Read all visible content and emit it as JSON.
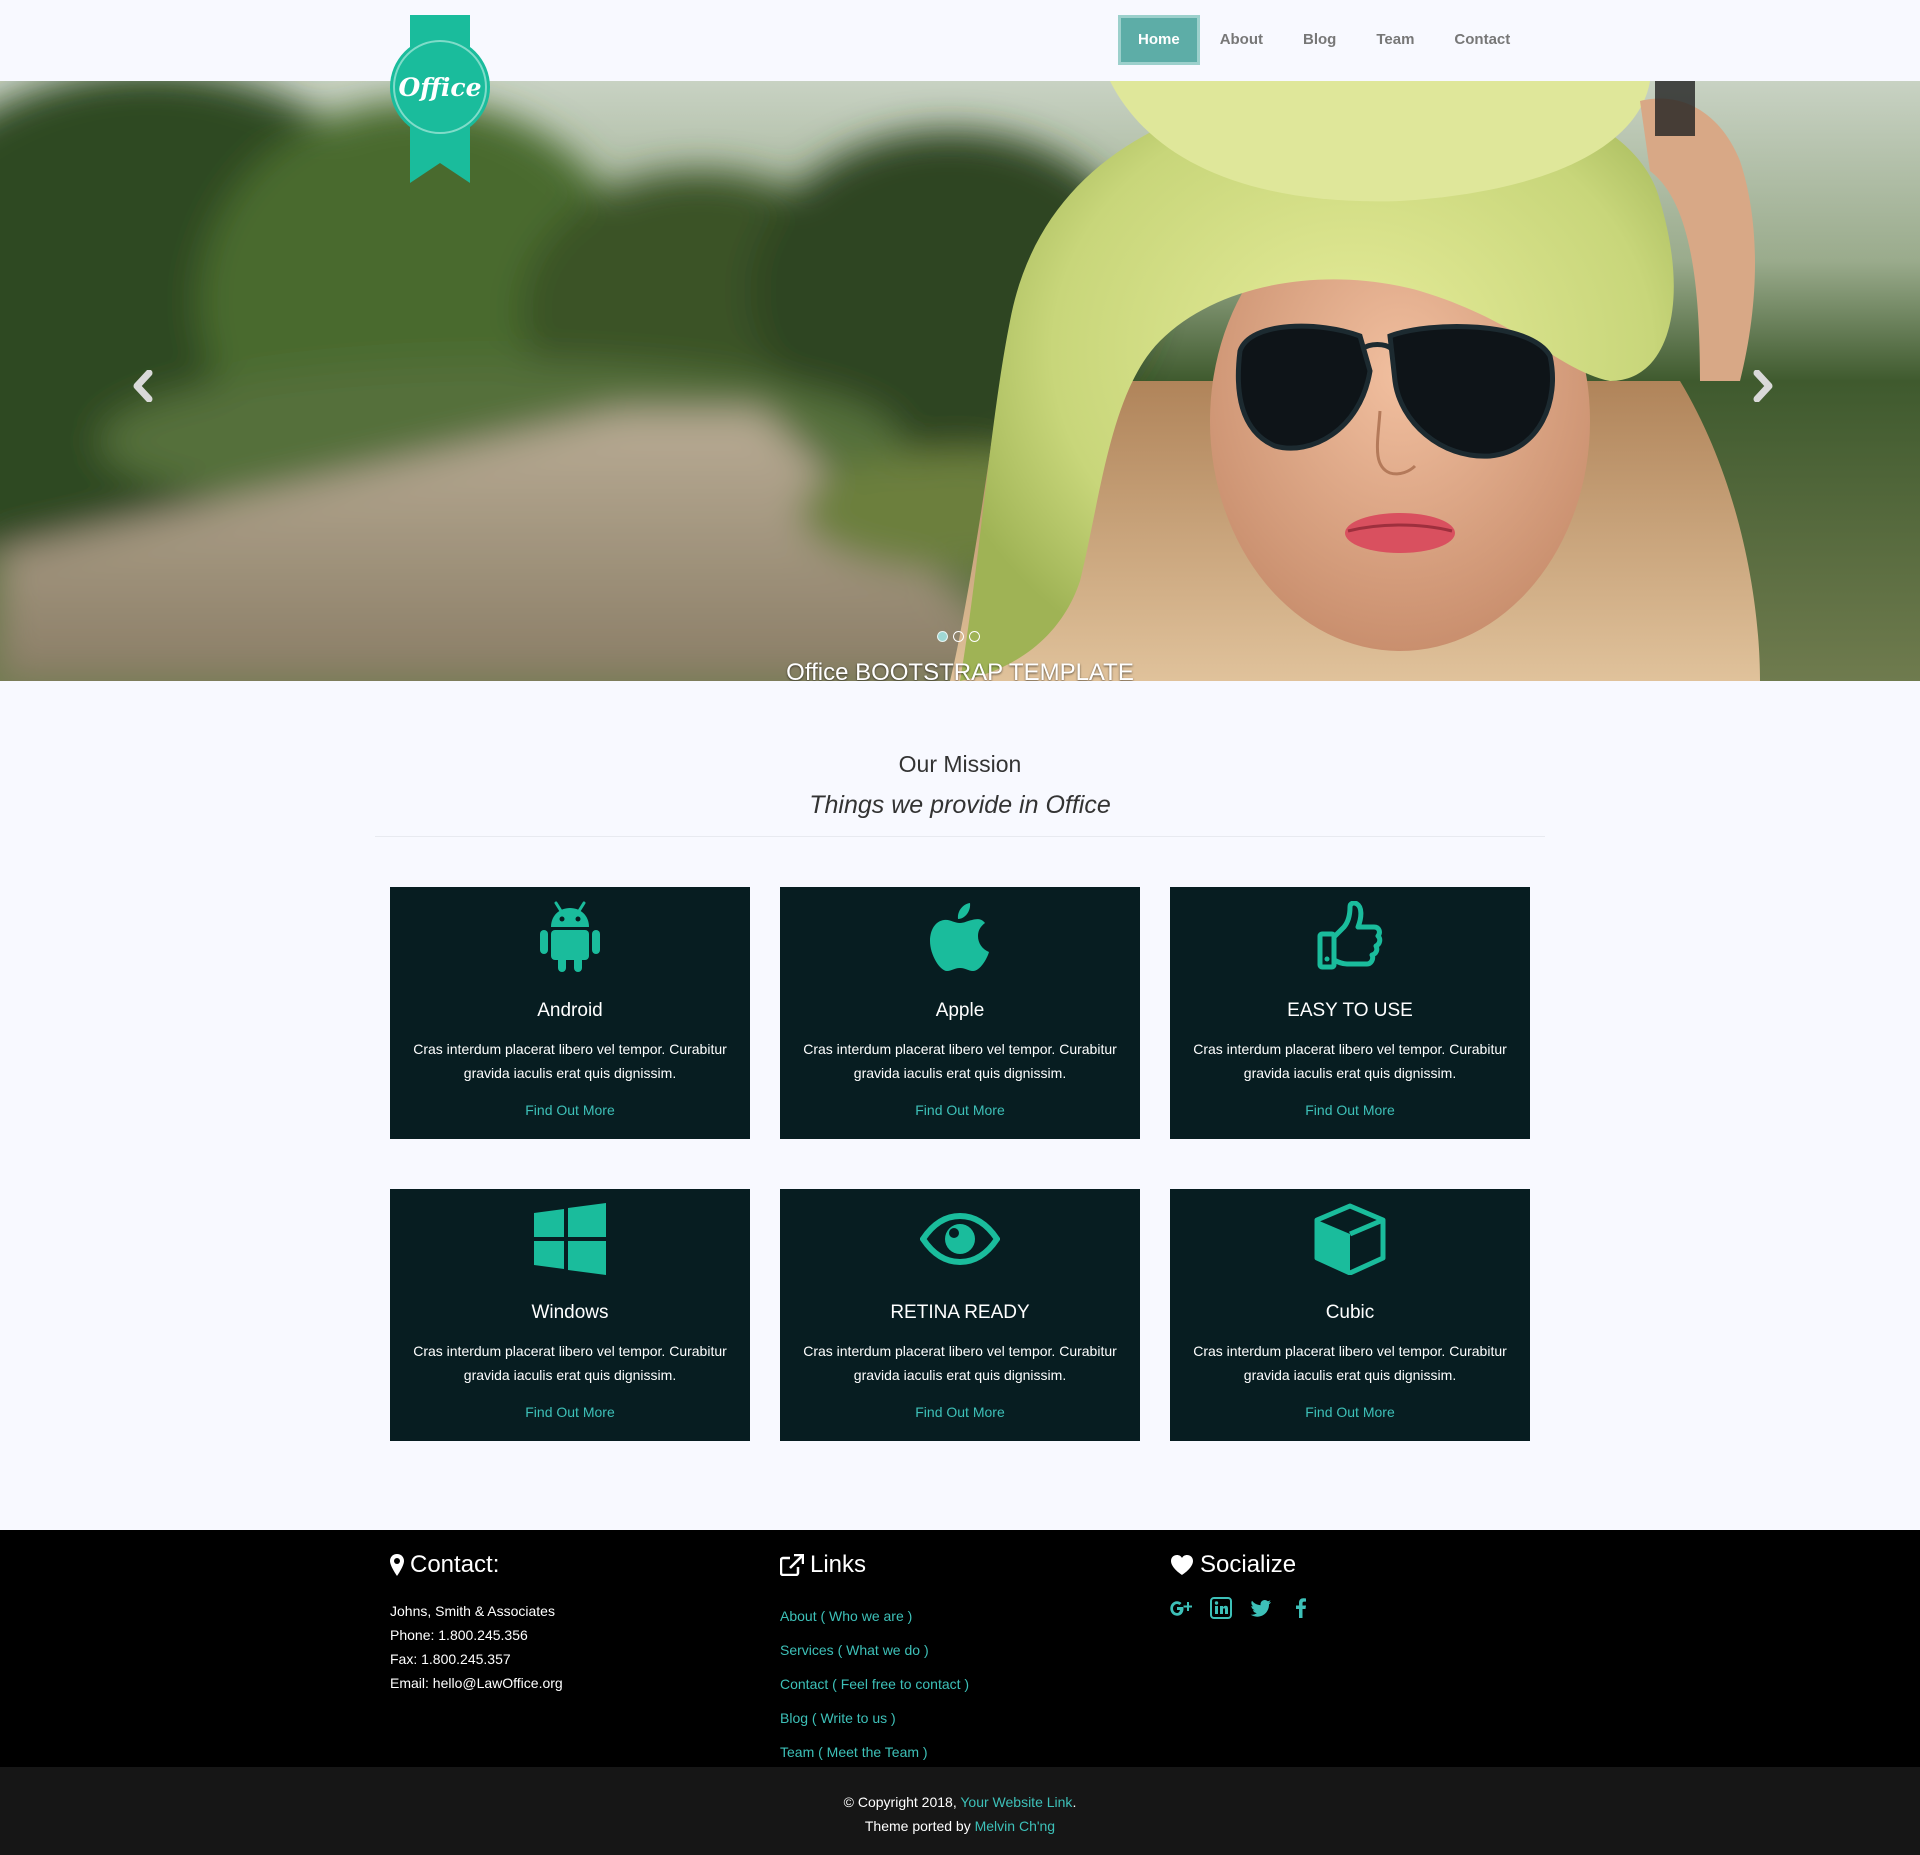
{
  "brand": {
    "logo_text": "Office",
    "accent_color": "#1abc9c"
  },
  "nav": {
    "items": [
      {
        "label": "Home",
        "active": true
      },
      {
        "label": "About",
        "active": false
      },
      {
        "label": "Blog",
        "active": false
      },
      {
        "label": "Team",
        "active": false
      },
      {
        "label": "Contact",
        "active": false
      }
    ]
  },
  "hero": {
    "caption": "Office BOOTSTRAP TEMPLATE",
    "prev_icon": "chevron-left-icon",
    "next_icon": "chevron-right-icon",
    "slide_count": 3,
    "active_slide": 1
  },
  "mission": {
    "title": "Our Mission",
    "subtitle": "Things we provide in Office"
  },
  "features": [
    {
      "icon": "android-icon",
      "title": "Android",
      "text": "Cras interdum placerat libero vel tempor. Curabitur gravida iaculis erat quis dignissim.",
      "link": "Find Out More"
    },
    {
      "icon": "apple-icon",
      "title": "Apple",
      "text": "Cras interdum placerat libero vel tempor. Curabitur gravida iaculis erat quis dignissim.",
      "link": "Find Out More"
    },
    {
      "icon": "thumbs-up-icon",
      "title": "EASY TO USE",
      "text": "Cras interdum placerat libero vel tempor. Curabitur gravida iaculis erat quis dignissim.",
      "link": "Find Out More"
    },
    {
      "icon": "windows-icon",
      "title": "Windows",
      "text": "Cras interdum placerat libero vel tempor. Curabitur gravida iaculis erat quis dignissim.",
      "link": "Find Out More"
    },
    {
      "icon": "eye-icon",
      "title": "RETINA READY",
      "text": "Cras interdum placerat libero vel tempor. Curabitur gravida iaculis erat quis dignissim.",
      "link": "Find Out More"
    },
    {
      "icon": "cube-icon",
      "title": "Cubic",
      "text": "Cras interdum placerat libero vel tempor. Curabitur gravida iaculis erat quis dignissim.",
      "link": "Find Out More"
    }
  ],
  "footer": {
    "contact": {
      "heading": "Contact:",
      "icon": "map-marker-icon",
      "lines": [
        "Johns, Smith & Associates",
        "Phone: 1.800.245.356",
        "Fax: 1.800.245.357",
        "Email: hello@LawOffice.org"
      ]
    },
    "links": {
      "heading": "Links",
      "icon": "external-link-icon",
      "items": [
        "About ( Who we are )",
        "Services ( What we do )",
        "Contact ( Feel free to contact )",
        "Blog ( Write to us )",
        "Team ( Meet the Team )"
      ]
    },
    "socialize": {
      "heading": "Socialize",
      "icon": "heart-icon",
      "networks": [
        "google-plus-icon",
        "linkedin-icon",
        "twitter-icon",
        "facebook-icon"
      ]
    }
  },
  "copyright": {
    "line1_prefix": "© Copyright 2018, ",
    "line1_link": "Your Website Link",
    "line1_suffix": ".",
    "line2_prefix": "Theme ported by ",
    "line2_link": "Melvin Ch'ng"
  }
}
